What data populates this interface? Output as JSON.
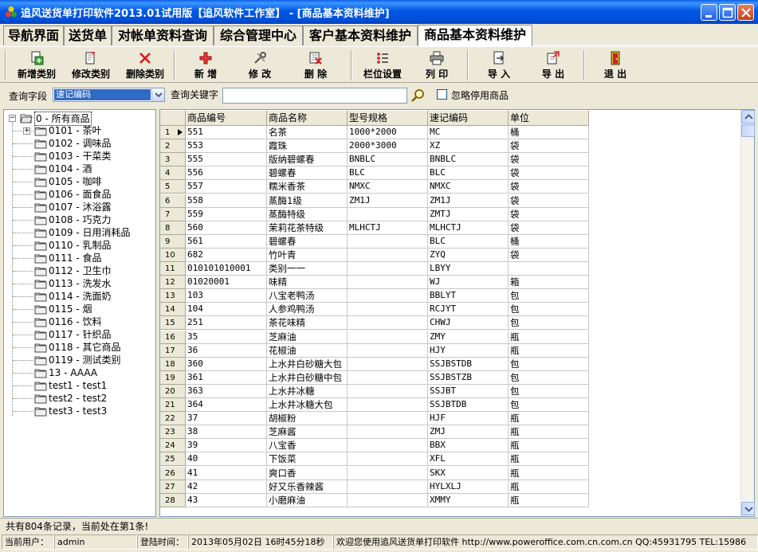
{
  "window": {
    "title": "追风送货单打印软件2013.01试用版【追风软件工作室】 - [商品基本资料维护]"
  },
  "tabs": [
    {
      "label": "导航界面"
    },
    {
      "label": "送货单"
    },
    {
      "label": "对帐单资料查询"
    },
    {
      "label": "综合管理中心"
    },
    {
      "label": "客户基本资料维护"
    },
    {
      "label": "商品基本资料维护",
      "active": true
    }
  ],
  "toolbar": {
    "add_category": "新增类别",
    "edit_category": "修改类别",
    "delete_category": "删除类别",
    "add": "新   增",
    "edit": "修   改",
    "delete": "删   除",
    "column_settings": "栏位设置",
    "print": "列   印",
    "import": "导   入",
    "export": "导   出",
    "exit": "退   出"
  },
  "search": {
    "field_label": "查询字段",
    "field_value": "速记编码",
    "keyword_label": "查询关键字",
    "keyword_value": "",
    "ignore_label": "忽略停用商品"
  },
  "tree": {
    "root": "0 - 所有商品",
    "items": [
      {
        "label": "0101 - 茶叶",
        "expandable": true
      },
      {
        "label": "0102 - 调味品"
      },
      {
        "label": "0103 - 干菜类"
      },
      {
        "label": "0104 - 酒"
      },
      {
        "label": "0105 - 咖啡"
      },
      {
        "label": "0106 - 面食品"
      },
      {
        "label": "0107 - 沐浴露"
      },
      {
        "label": "0108 - 巧克力"
      },
      {
        "label": "0109 - 日用消耗品"
      },
      {
        "label": "0110 - 乳制品"
      },
      {
        "label": "0111 - 食品"
      },
      {
        "label": "0112 - 卫生巾"
      },
      {
        "label": "0113 - 洗发水"
      },
      {
        "label": "0114 - 洗面奶"
      },
      {
        "label": "0115 - 烟"
      },
      {
        "label": "0116 - 饮料"
      },
      {
        "label": "0117 - 针织品"
      },
      {
        "label": "0118 - 其它商品"
      },
      {
        "label": "0119 - 测试类别"
      },
      {
        "label": "13 - AAAA"
      },
      {
        "label": "test1 - test1"
      },
      {
        "label": "test2 - test2"
      },
      {
        "label": "test3 - test3"
      }
    ]
  },
  "grid": {
    "columns": [
      "商品编号",
      "商品名称",
      "型号规格",
      "速记编码",
      "单位"
    ],
    "current_row": 1,
    "rows": [
      {
        "n": "1",
        "code": "551",
        "name": "名茶",
        "spec": "1000*2000",
        "quick": "MC",
        "unit": "桶"
      },
      {
        "n": "2",
        "code": "553",
        "name": "霞珠",
        "spec": "2000*3000",
        "quick": "XZ",
        "unit": "袋"
      },
      {
        "n": "3",
        "code": "555",
        "name": "版纳碧螺春",
        "spec": "BNBLC",
        "quick": "BNBLC",
        "unit": "袋"
      },
      {
        "n": "4",
        "code": "556",
        "name": "碧螺春",
        "spec": "BLC",
        "quick": "BLC",
        "unit": "袋"
      },
      {
        "n": "5",
        "code": "557",
        "name": "糯米香茶",
        "spec": "NMXC",
        "quick": "NMXC",
        "unit": "袋"
      },
      {
        "n": "6",
        "code": "558",
        "name": "蒸酶1级",
        "spec": "ZM1J",
        "quick": "ZM1J",
        "unit": "袋"
      },
      {
        "n": "7",
        "code": "559",
        "name": "蒸酶特级",
        "spec": "",
        "quick": "ZMTJ",
        "unit": "袋"
      },
      {
        "n": "8",
        "code": "560",
        "name": "茉莉花茶特级",
        "spec": "MLHCTJ",
        "quick": "MLHCTJ",
        "unit": "袋"
      },
      {
        "n": "9",
        "code": "561",
        "name": "碧螺春",
        "spec": "",
        "quick": "BLC",
        "unit": "桶"
      },
      {
        "n": "10",
        "code": "682",
        "name": "竹叶青",
        "spec": "",
        "quick": "ZYQ",
        "unit": "袋"
      },
      {
        "n": "11",
        "code": "010101010001",
        "name": "类别一一",
        "spec": "",
        "quick": "LBYY",
        "unit": ""
      },
      {
        "n": "12",
        "code": "01020001",
        "name": "味精",
        "spec": "",
        "quick": "WJ",
        "unit": "箱"
      },
      {
        "n": "13",
        "code": "103",
        "name": "八宝老鸭汤",
        "spec": "",
        "quick": "BBLYT",
        "unit": "包"
      },
      {
        "n": "14",
        "code": "104",
        "name": "人参鸡鸭汤",
        "spec": "",
        "quick": "RCJYT",
        "unit": "包"
      },
      {
        "n": "15",
        "code": "251",
        "name": "茶花味精",
        "spec": "",
        "quick": "CHWJ",
        "unit": "包"
      },
      {
        "n": "16",
        "code": "35",
        "name": "芝麻油",
        "spec": "",
        "quick": "ZMY",
        "unit": "瓶"
      },
      {
        "n": "17",
        "code": "36",
        "name": "花椒油",
        "spec": "",
        "quick": "HJY",
        "unit": "瓶"
      },
      {
        "n": "18",
        "code": "360",
        "name": "上水井白砂糖大包",
        "spec": "",
        "quick": "SSJBSTDB",
        "unit": "包"
      },
      {
        "n": "19",
        "code": "361",
        "name": "上水井白砂糖中包",
        "spec": "",
        "quick": "SSJBSTZB",
        "unit": "包"
      },
      {
        "n": "20",
        "code": "363",
        "name": "上水井冰糖",
        "spec": "",
        "quick": "SSJBT",
        "unit": "包"
      },
      {
        "n": "21",
        "code": "364",
        "name": "上水井冰糖大包",
        "spec": "",
        "quick": "SSJBTDB",
        "unit": "包"
      },
      {
        "n": "22",
        "code": "37",
        "name": "胡椒粉",
        "spec": "",
        "quick": "HJF",
        "unit": "瓶"
      },
      {
        "n": "23",
        "code": "38",
        "name": "芝麻酱",
        "spec": "",
        "quick": "ZMJ",
        "unit": "瓶"
      },
      {
        "n": "24",
        "code": "39",
        "name": "八宝香",
        "spec": "",
        "quick": "BBX",
        "unit": "瓶"
      },
      {
        "n": "25",
        "code": "40",
        "name": "下饭菜",
        "spec": "",
        "quick": "XFL",
        "unit": "瓶"
      },
      {
        "n": "26",
        "code": "41",
        "name": "爽口香",
        "spec": "",
        "quick": "SKX",
        "unit": "瓶"
      },
      {
        "n": "27",
        "code": "42",
        "name": "好又乐香辣酱",
        "spec": "",
        "quick": "HYLXLJ",
        "unit": "瓶"
      },
      {
        "n": "28",
        "code": "43",
        "name": "小磨麻油",
        "spec": "",
        "quick": "XMMY",
        "unit": "瓶"
      }
    ]
  },
  "status": {
    "records": "共有804条记录，当前处在第1条!",
    "user_label": "当前用户：",
    "user": "admin",
    "login_label": "登陆时间：",
    "login_time": "2013年05月02日 16时45分18秒",
    "message": "欢迎您使用追风送货单打印软件 http://www.poweroffice.com.cn.com.cn QQ:45931795 TEL:15986"
  },
  "colors": {
    "titlebar": "#0058e6",
    "selection": "#316ac5",
    "face": "#ece9d8"
  }
}
